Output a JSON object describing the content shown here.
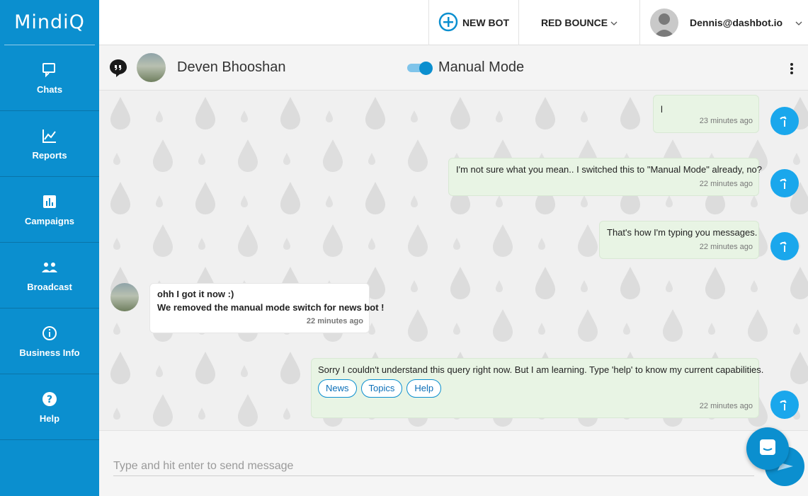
{
  "brand": {
    "logo_text": "MindiQ"
  },
  "sidebar": {
    "items": [
      {
        "label": "Chats",
        "icon": "chat-bubbles-icon"
      },
      {
        "label": "Reports",
        "icon": "line-chart-icon"
      },
      {
        "label": "Campaigns",
        "icon": "bar-chart-icon"
      },
      {
        "label": "Broadcast",
        "icon": "people-icon"
      },
      {
        "label": "Business Info",
        "icon": "info-icon"
      },
      {
        "label": "Help",
        "icon": "help-icon"
      }
    ]
  },
  "topbar": {
    "new_bot_label": "NEW BOT",
    "bot_selector_label": "RED BOUNCE",
    "user_email": "Dennis@dashbot.io"
  },
  "chat_header": {
    "contact_name": "Deven Bhooshan",
    "mode_label": "Manual Mode",
    "manual_mode_on": true
  },
  "messages": [
    {
      "sender": "bot",
      "text": "l",
      "time": "23 minutes ago"
    },
    {
      "sender": "bot",
      "text": "I'm not sure what you mean.. I switched this to \"Manual Mode\" already, no?",
      "time": "22 minutes ago"
    },
    {
      "sender": "bot",
      "text": "That's how I'm typing you messages.",
      "time": "22 minutes ago"
    },
    {
      "sender": "user",
      "line1": "ohh I got it now :)",
      "line2": "We removed the manual mode switch for news bot !",
      "time": "22 minutes ago"
    },
    {
      "sender": "bot",
      "text": "Sorry I couldn't understand this query right now. But I am learning. Type 'help' to know my current capabilities.",
      "chips": [
        "News",
        "Topics",
        "Help"
      ],
      "time": "22 minutes ago"
    }
  ],
  "composer": {
    "placeholder": "Type and hit enter to send message"
  },
  "colors": {
    "brand": "#0b8fcf",
    "bot_bubble": "#e8f4e4",
    "avatar_blue": "#1aa7ec"
  }
}
